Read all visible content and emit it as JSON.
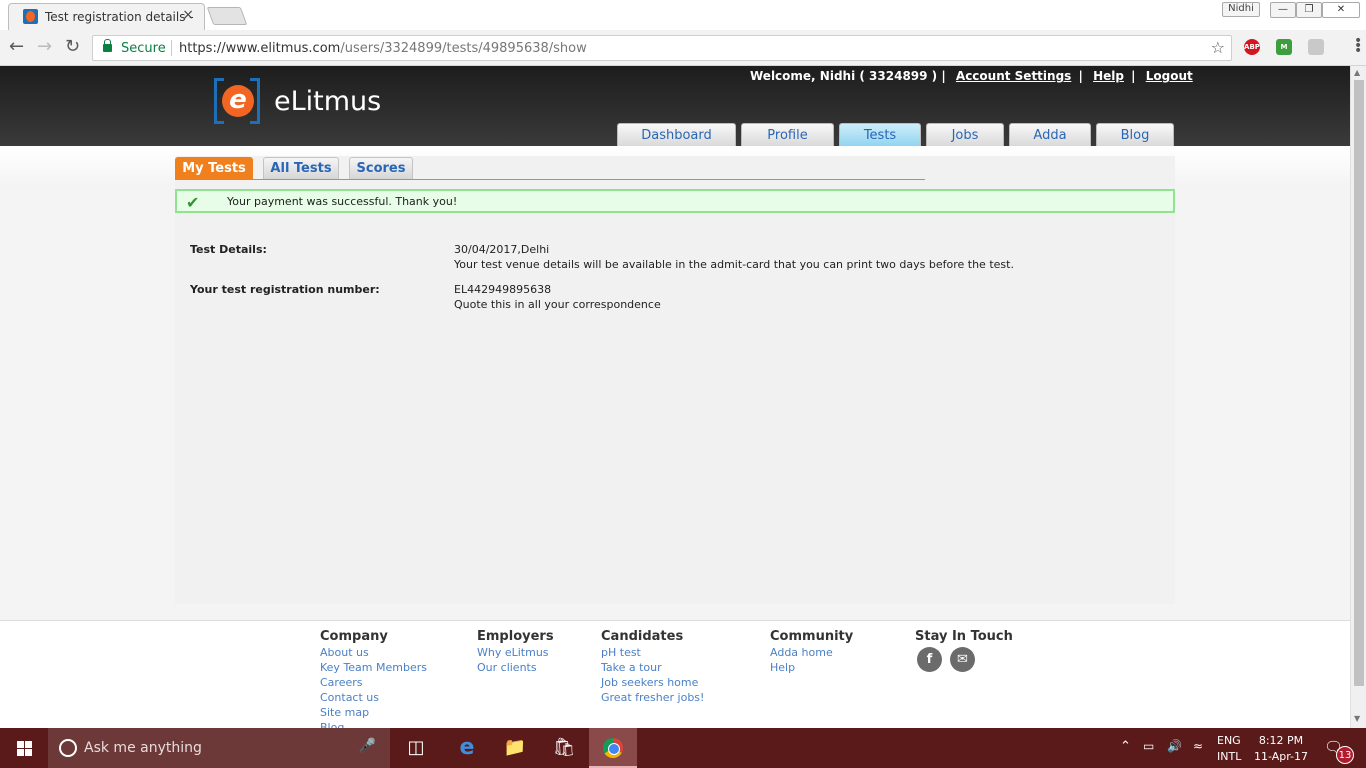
{
  "browser": {
    "tab_title": "Test registration details -",
    "tab_close": "×",
    "profile_name": "Nidhi",
    "secure_label": "Secure",
    "url_host": "https://www.elitmus.com",
    "url_path": "/users/3324899/tests/49895638/show",
    "abp_label": "ABP",
    "ext_green_label": "M",
    "win_min": "—",
    "win_max": "❐",
    "win_close": "✕"
  },
  "site": {
    "name": "eLitmus",
    "logo_letter": "e",
    "welcome": "Welcome, Nidhi ( 3324899 ) |",
    "account_settings": "Account Settings",
    "pipe1": "|",
    "help": "Help",
    "pipe2": "|",
    "logout": "Logout",
    "nav": [
      "Dashboard",
      "Profile",
      "Tests",
      "Jobs",
      "Adda",
      "Blog"
    ]
  },
  "subtabs": [
    "My Tests",
    "All Tests",
    "Scores"
  ],
  "alert": {
    "message": "Your payment was successful. Thank you!"
  },
  "details": {
    "test_label": "Test Details:",
    "test_date_place": "30/04/2017,Delhi",
    "test_note": "Your test venue details will be available in the admit-card that you can print two days before the test.",
    "reg_label": "Your test registration number:",
    "reg_number": "EL442949895638",
    "reg_note": "Quote this in all your correspondence"
  },
  "footer": {
    "company": {
      "title": "Company",
      "links": [
        "About us",
        "Key Team Members",
        "Careers",
        "Contact us",
        "Site map",
        "Blog"
      ]
    },
    "employers": {
      "title": "Employers",
      "links": [
        "Why eLitmus",
        "Our clients"
      ]
    },
    "candidates": {
      "title": "Candidates",
      "links": [
        "pH test",
        "Take a tour",
        "Job seekers home",
        "Great fresher jobs!"
      ]
    },
    "community": {
      "title": "Community",
      "links": [
        "Adda home",
        "Help"
      ]
    },
    "stay": {
      "title": "Stay In Touch",
      "facebook": "f",
      "email": "✉"
    }
  },
  "taskbar": {
    "search_placeholder": "Ask me anything",
    "lang_top": "ENG",
    "lang_bottom": "INTL",
    "time": "8:12 PM",
    "date": "11-Apr-17",
    "notifications": "13"
  },
  "colors": {
    "accent": "#f07f1e",
    "link": "#2a66b5",
    "success_bg": "#e8fde8",
    "taskbar": "#5a1a1a"
  }
}
